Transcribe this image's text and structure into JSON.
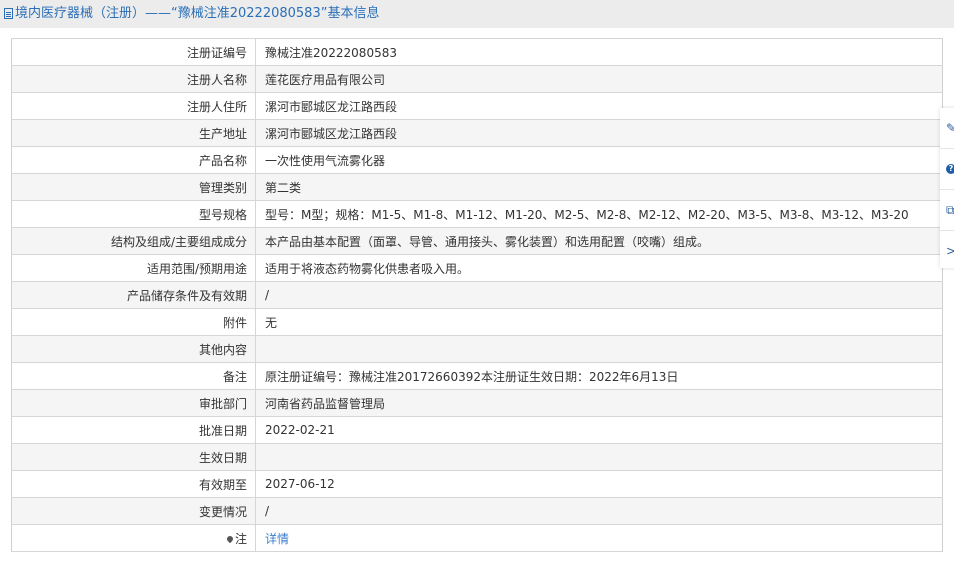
{
  "header": {
    "title": "境内医疗器械（注册）——“豫械注准20222080583”基本信息"
  },
  "rows": [
    {
      "label": "注册证编号",
      "value": "豫械注准20222080583"
    },
    {
      "label": "注册人名称",
      "value": "莲花医疗用品有限公司"
    },
    {
      "label": "注册人住所",
      "value": "漯河市郾城区龙江路西段"
    },
    {
      "label": "生产地址",
      "value": "漯河市郾城区龙江路西段"
    },
    {
      "label": "产品名称",
      "value": "一次性使用气流雾化器"
    },
    {
      "label": "管理类别",
      "value": "第二类"
    },
    {
      "label": "型号规格",
      "value": "型号：M型；规格：M1-5、M1-8、M1-12、M1-20、M2-5、M2-8、M2-12、M2-20、M3-5、M3-8、M3-12、M3-20"
    },
    {
      "label": "结构及组成/主要组成成分",
      "value": "本产品由基本配置（面罩、导管、通用接头、雾化装置）和选用配置（咬嘴）组成。"
    },
    {
      "label": "适用范围/预期用途",
      "value": "适用于将液态药物雾化供患者吸入用。"
    },
    {
      "label": "产品储存条件及有效期",
      "value": "/"
    },
    {
      "label": "附件",
      "value": "无"
    },
    {
      "label": "其他内容",
      "value": ""
    },
    {
      "label": "备注",
      "value": "原注册证编号：豫械注准20172660392本注册证生效日期：2022年6月13日"
    },
    {
      "label": "审批部门",
      "value": "河南省药品监督管理局"
    },
    {
      "label": "批准日期",
      "value": "2022-02-21"
    },
    {
      "label": "生效日期",
      "value": ""
    },
    {
      "label": "有效期至",
      "value": "2027-06-12"
    },
    {
      "label": "变更情况",
      "value": "/"
    }
  ],
  "note": {
    "label": "注",
    "link": "详情"
  },
  "sidebar": {
    "icons": [
      "edit-icon",
      "help-icon",
      "copy-icon",
      "chevron-right-icon"
    ],
    "help_glyph": "?",
    "chevron_glyph": ">"
  }
}
